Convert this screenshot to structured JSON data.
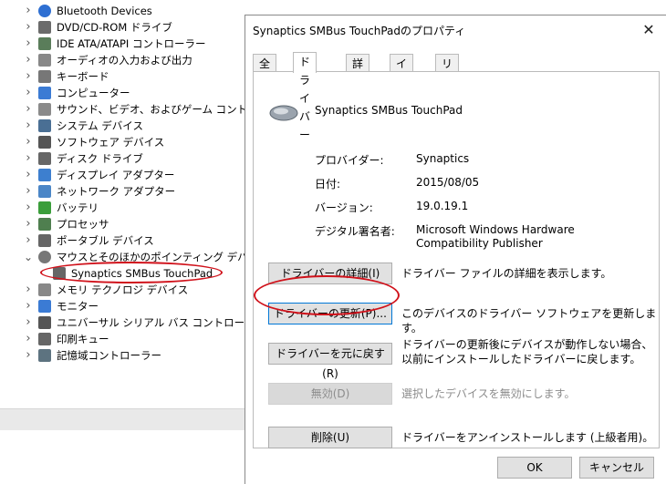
{
  "tree": {
    "items": [
      {
        "label": "Bluetooth Devices",
        "icon": "bluetooth-icon",
        "expanded": false
      },
      {
        "label": "DVD/CD-ROM ドライブ",
        "icon": "disc-drive-icon",
        "expanded": false
      },
      {
        "label": "IDE ATA/ATAPI コントローラー",
        "icon": "ide-controller-icon",
        "expanded": false
      },
      {
        "label": "オーディオの入力および出力",
        "icon": "speaker-icon",
        "expanded": false
      },
      {
        "label": "キーボード",
        "icon": "keyboard-icon",
        "expanded": false
      },
      {
        "label": "コンピューター",
        "icon": "computer-icon",
        "expanded": false
      },
      {
        "label": "サウンド、ビデオ、およびゲーム コントローラー",
        "icon": "sound-icon",
        "expanded": false
      },
      {
        "label": "システム デバイス",
        "icon": "system-device-icon",
        "expanded": false
      },
      {
        "label": "ソフトウェア デバイス",
        "icon": "software-device-icon",
        "expanded": false
      },
      {
        "label": "ディスク ドライブ",
        "icon": "disk-drive-icon",
        "expanded": false
      },
      {
        "label": "ディスプレイ アダプター",
        "icon": "display-adapter-icon",
        "expanded": false
      },
      {
        "label": "ネットワーク アダプター",
        "icon": "network-adapter-icon",
        "expanded": false
      },
      {
        "label": "バッテリ",
        "icon": "battery-icon",
        "expanded": false
      },
      {
        "label": "プロセッサ",
        "icon": "processor-icon",
        "expanded": false
      },
      {
        "label": "ポータブル デバイス",
        "icon": "portable-device-icon",
        "expanded": false
      },
      {
        "label": "マウスとそのほかのポインティング デバイス",
        "icon": "mouse-icon",
        "expanded": true
      },
      {
        "label": "Synaptics SMBus TouchPad",
        "icon": "touchpad-icon",
        "child": true
      },
      {
        "label": "メモリ テクノロジ デバイス",
        "icon": "memory-icon",
        "expanded": false
      },
      {
        "label": "モニター",
        "icon": "monitor-icon",
        "expanded": false
      },
      {
        "label": "ユニバーサル シリアル バス コントローラー",
        "icon": "usb-icon",
        "expanded": false
      },
      {
        "label": "印刷キュー",
        "icon": "printer-icon",
        "expanded": false
      },
      {
        "label": "記憶域コントローラー",
        "icon": "storage-controller-icon",
        "expanded": false
      }
    ]
  },
  "dialog": {
    "title": "Synaptics SMBus TouchPadのプロパティ",
    "close": "✕",
    "tabs": [
      "全般",
      "ドライバー",
      "詳細",
      "イベント",
      "リソース"
    ],
    "active_tab": "ドライバー",
    "device_name": "Synaptics SMBus TouchPad",
    "info": {
      "provider_label": "プロバイダー:",
      "provider": "Synaptics",
      "date_label": "日付:",
      "date": "2015/08/05",
      "version_label": "バージョン:",
      "version": "19.0.19.1",
      "signer_label": "デジタル署名者:",
      "signer": "Microsoft Windows Hardware Compatibility Publisher"
    },
    "buttons": {
      "details": "ドライバーの詳細(I)",
      "details_desc": "ドライバー ファイルの詳細を表示します。",
      "update": "ドライバーの更新(P)...",
      "update_desc": "このデバイスのドライバー ソフトウェアを更新します。",
      "rollback": "ドライバーを元に戻す(R)",
      "rollback_desc": "ドライバーの更新後にデバイスが動作しない場合、以前にインストールしたドライバーに戻します。",
      "disable": "無効(D)",
      "disable_desc": "選択したデバイスを無効にします。",
      "uninstall": "削除(U)",
      "uninstall_desc": "ドライバーをアンインストールします (上級者用)。"
    },
    "footer": {
      "ok": "OK",
      "cancel": "キャンセル"
    }
  },
  "colors": {
    "highlight": "#d0121b",
    "button": "#e1e1e1"
  }
}
